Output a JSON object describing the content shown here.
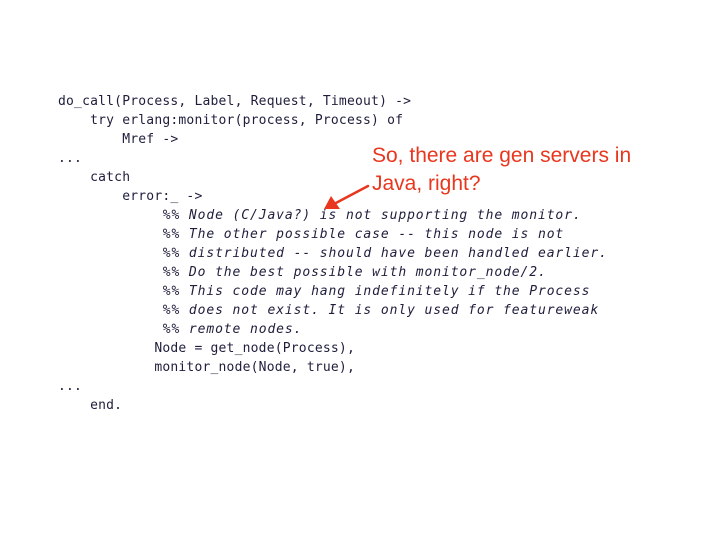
{
  "code_lines": [
    "do_call(Process, Label, Request, Timeout) ->",
    "    try erlang:monitor(process, Process) of",
    "        Mref ->",
    "...",
    "    catch",
    "        error:_ ->",
    "            %% Node (C/Java?) is not supporting the monitor.",
    "            %% The other possible case -- this node is not",
    "            %% distributed -- should have been handled earlier.",
    "            %% Do the best possible with monitor_node/2.",
    "            %% This code may hang indefinitely if the Process",
    "            %% does not exist. It is only used for featureweak",
    "            %% remote nodes.",
    "            Node = get_node(Process),",
    "            monitor_node(Node, true),",
    "...",
    "    end."
  ],
  "callout": {
    "text": "So, there are gen servers in\nJava, right?",
    "color": "#e8371e"
  },
  "colors": {
    "code_text": "#1e1e3c",
    "background": "#ffffff",
    "arrow": "#e8371e"
  },
  "icons": {
    "arrow": "arrow-pointer-icon"
  }
}
